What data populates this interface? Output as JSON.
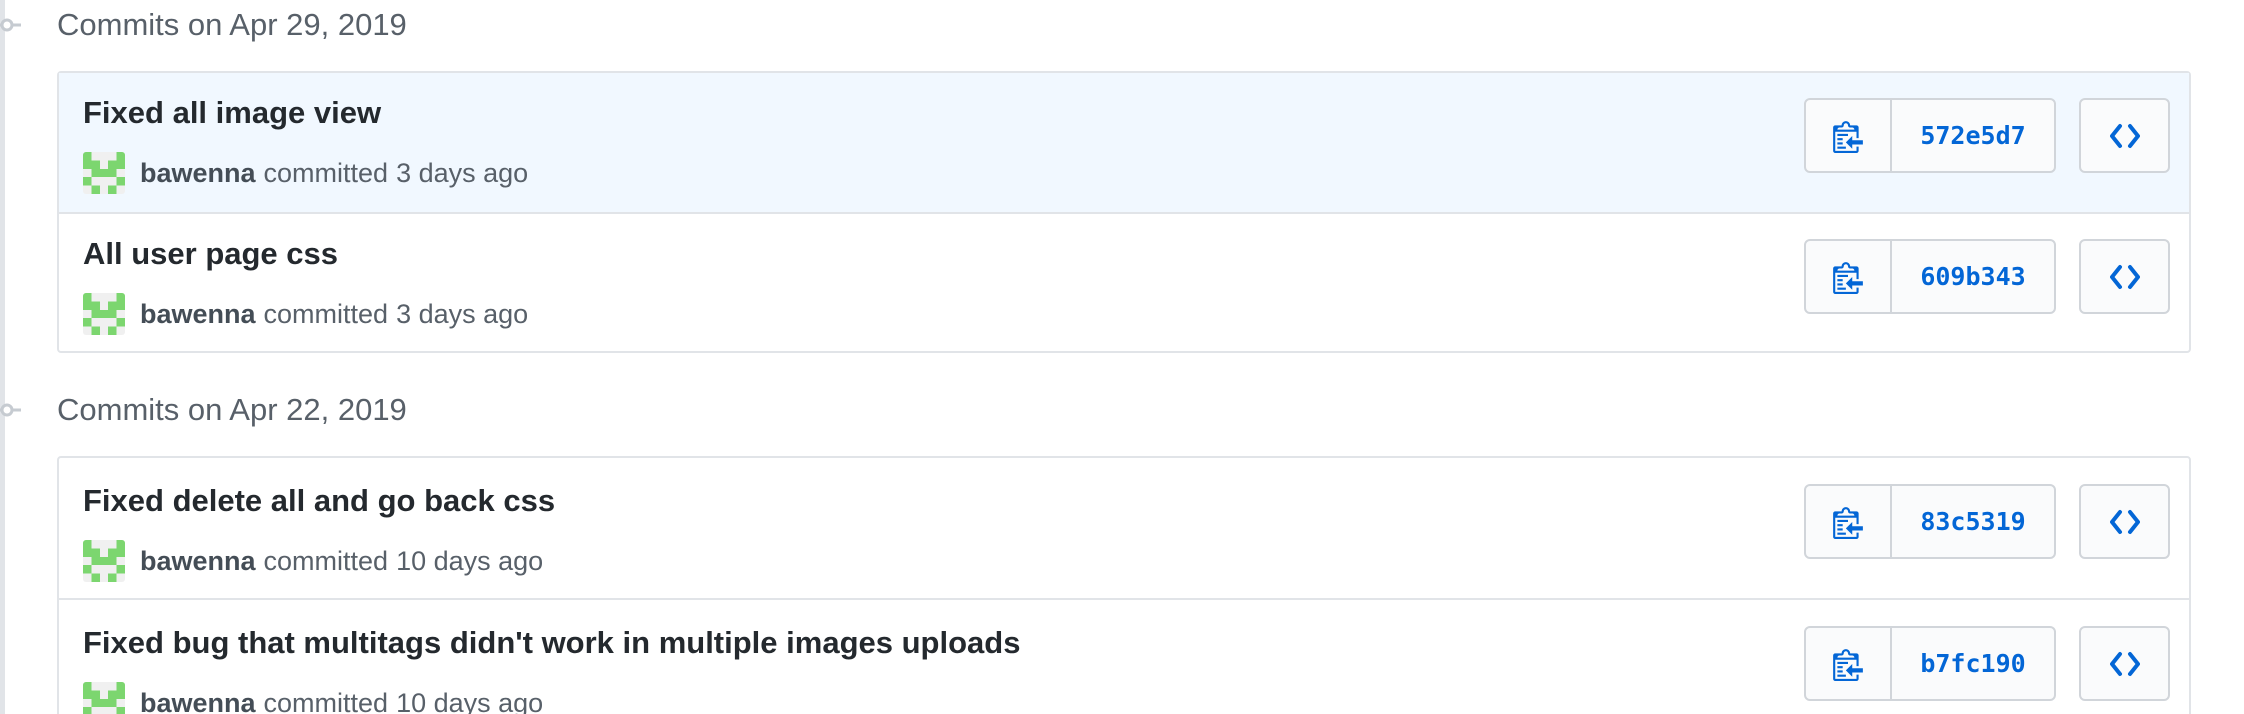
{
  "colors": {
    "link_blue": "#0366d6",
    "highlight_row": "#f1f8ff",
    "border": "#e1e4e8",
    "avatar_green": "#7cd66f"
  },
  "groups": [
    {
      "heading": "Commits on Apr 29, 2019",
      "commits": [
        {
          "title": "Fixed all image view",
          "author": "bawenna",
          "committed": "committed",
          "time": "3 days ago",
          "sha": "572e5d7",
          "highlighted": true
        },
        {
          "title": "All user page css",
          "author": "bawenna",
          "committed": "committed",
          "time": "3 days ago",
          "sha": "609b343",
          "highlighted": false
        }
      ]
    },
    {
      "heading": "Commits on Apr 22, 2019",
      "commits": [
        {
          "title": "Fixed delete all and go back css",
          "author": "bawenna",
          "committed": "committed",
          "time": "10 days ago",
          "sha": "83c5319",
          "highlighted": false
        },
        {
          "title": "Fixed bug that multitags didn't work in multiple images uploads",
          "author": "bawenna",
          "committed": "committed",
          "time": "10 days ago",
          "sha": "b7fc190",
          "highlighted": false
        }
      ]
    }
  ],
  "icons": {
    "commit_node": "git-commit-icon",
    "copy": "clipboard-copy-icon",
    "browse": "code-browse-icon",
    "avatar": "identicon-avatar"
  }
}
